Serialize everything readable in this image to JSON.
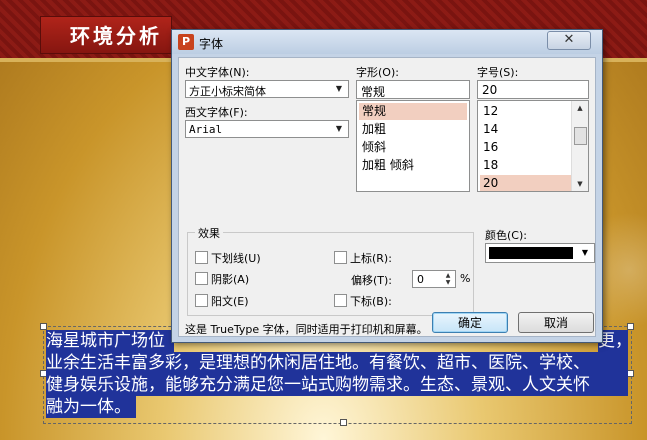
{
  "slide": {
    "title": "环境分析",
    "body_lines": [
      "海星城市广场位",
      "业余生活丰富多彩，是理想的休闲居住地。有餐饮、超市、医院、学校、",
      "健身娱乐设施，能够充分满足您一站式购物需求。生态、景观、人文关怀",
      "融为一体。"
    ],
    "body_fragment_right": "更，"
  },
  "dialog": {
    "title": "字体",
    "close": "✕",
    "chinese_font_label": "中文字体(N):",
    "chinese_font_value": "方正小标宋简体",
    "western_font_label": "西文字体(F):",
    "western_font_value": "Arial",
    "style_label": "字形(O):",
    "style_value": "常规",
    "style_options": [
      "常规",
      "加粗",
      "倾斜",
      "加粗 倾斜"
    ],
    "size_label": "字号(S):",
    "size_value": "20",
    "size_options": [
      "12",
      "14",
      "16",
      "18",
      "20"
    ],
    "effects_label": "效果",
    "underline_label": "下划线(U)",
    "shadow_label": "阴影(A)",
    "emboss_label": "阳文(E)",
    "superscript_label": "上标(R):",
    "offset_label": "偏移(T):",
    "offset_value": "0",
    "offset_unit": "%",
    "subscript_label": "下标(B):",
    "color_label": "颜色(C):",
    "color_value": "#000000",
    "note": "这是 TrueType 字体，同时适用于打印机和屏幕。",
    "ok": "确定",
    "cancel": "取消"
  }
}
